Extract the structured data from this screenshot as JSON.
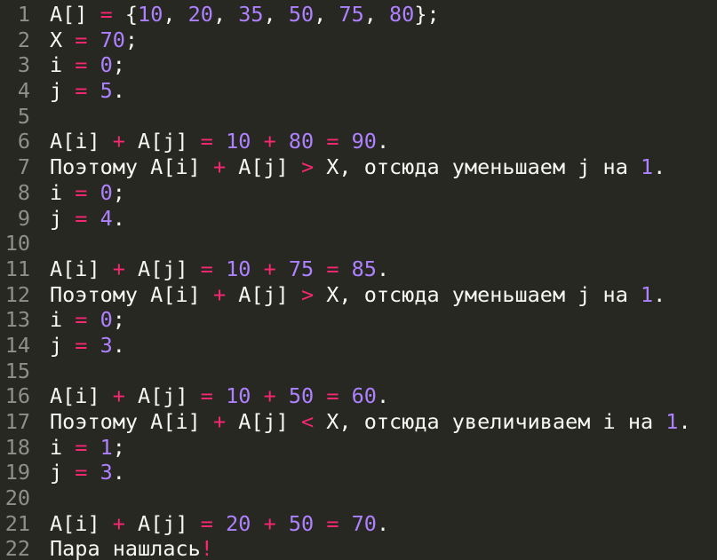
{
  "colors": {
    "background": "#272822",
    "text": "#f8f8f2",
    "line_number": "#90908a",
    "operator": "#f92672",
    "number": "#ae81ff"
  },
  "lines": [
    {
      "num": "1",
      "tokens": [
        [
          "t",
          "A[] "
        ],
        [
          "o",
          "="
        ],
        [
          "t",
          " {"
        ],
        [
          "n",
          "10"
        ],
        [
          "t",
          ", "
        ],
        [
          "n",
          "20"
        ],
        [
          "t",
          ", "
        ],
        [
          "n",
          "35"
        ],
        [
          "t",
          ", "
        ],
        [
          "n",
          "50"
        ],
        [
          "t",
          ", "
        ],
        [
          "n",
          "75"
        ],
        [
          "t",
          ", "
        ],
        [
          "n",
          "80"
        ],
        [
          "t",
          "};"
        ]
      ]
    },
    {
      "num": "2",
      "tokens": [
        [
          "t",
          "X "
        ],
        [
          "o",
          "="
        ],
        [
          "t",
          " "
        ],
        [
          "n",
          "70"
        ],
        [
          "t",
          ";"
        ]
      ]
    },
    {
      "num": "3",
      "tokens": [
        [
          "t",
          "i "
        ],
        [
          "o",
          "="
        ],
        [
          "t",
          " "
        ],
        [
          "n",
          "0"
        ],
        [
          "t",
          ";"
        ]
      ]
    },
    {
      "num": "4",
      "tokens": [
        [
          "t",
          "j "
        ],
        [
          "o",
          "="
        ],
        [
          "t",
          " "
        ],
        [
          "n",
          "5"
        ],
        [
          "t",
          "."
        ]
      ]
    },
    {
      "num": "5",
      "tokens": []
    },
    {
      "num": "6",
      "tokens": [
        [
          "t",
          "A[i] "
        ],
        [
          "o",
          "+"
        ],
        [
          "t",
          " A[j] "
        ],
        [
          "o",
          "="
        ],
        [
          "t",
          " "
        ],
        [
          "n",
          "10"
        ],
        [
          "t",
          " "
        ],
        [
          "o",
          "+"
        ],
        [
          "t",
          " "
        ],
        [
          "n",
          "80"
        ],
        [
          "t",
          " "
        ],
        [
          "o",
          "="
        ],
        [
          "t",
          " "
        ],
        [
          "n",
          "90"
        ],
        [
          "t",
          "."
        ]
      ]
    },
    {
      "num": "7",
      "tokens": [
        [
          "t",
          "Поэтому A[i] "
        ],
        [
          "o",
          "+"
        ],
        [
          "t",
          " A[j] "
        ],
        [
          "o",
          ">"
        ],
        [
          "t",
          " X, отсюда уменьшаем j на "
        ],
        [
          "n",
          "1"
        ],
        [
          "t",
          "."
        ]
      ]
    },
    {
      "num": "8",
      "tokens": [
        [
          "t",
          "i "
        ],
        [
          "o",
          "="
        ],
        [
          "t",
          " "
        ],
        [
          "n",
          "0"
        ],
        [
          "t",
          ";"
        ]
      ]
    },
    {
      "num": "9",
      "tokens": [
        [
          "t",
          "j "
        ],
        [
          "o",
          "="
        ],
        [
          "t",
          " "
        ],
        [
          "n",
          "4"
        ],
        [
          "t",
          "."
        ]
      ]
    },
    {
      "num": "10",
      "tokens": []
    },
    {
      "num": "11",
      "tokens": [
        [
          "t",
          "A[i] "
        ],
        [
          "o",
          "+"
        ],
        [
          "t",
          " A[j] "
        ],
        [
          "o",
          "="
        ],
        [
          "t",
          " "
        ],
        [
          "n",
          "10"
        ],
        [
          "t",
          " "
        ],
        [
          "o",
          "+"
        ],
        [
          "t",
          " "
        ],
        [
          "n",
          "75"
        ],
        [
          "t",
          " "
        ],
        [
          "o",
          "="
        ],
        [
          "t",
          " "
        ],
        [
          "n",
          "85"
        ],
        [
          "t",
          "."
        ]
      ]
    },
    {
      "num": "12",
      "tokens": [
        [
          "t",
          "Поэтому A[i] "
        ],
        [
          "o",
          "+"
        ],
        [
          "t",
          " A[j] "
        ],
        [
          "o",
          ">"
        ],
        [
          "t",
          " X, отсюда уменьшаем j на "
        ],
        [
          "n",
          "1"
        ],
        [
          "t",
          "."
        ]
      ]
    },
    {
      "num": "13",
      "tokens": [
        [
          "t",
          "i "
        ],
        [
          "o",
          "="
        ],
        [
          "t",
          " "
        ],
        [
          "n",
          "0"
        ],
        [
          "t",
          ";"
        ]
      ]
    },
    {
      "num": "14",
      "tokens": [
        [
          "t",
          "j "
        ],
        [
          "o",
          "="
        ],
        [
          "t",
          " "
        ],
        [
          "n",
          "3"
        ],
        [
          "t",
          "."
        ]
      ]
    },
    {
      "num": "15",
      "tokens": []
    },
    {
      "num": "16",
      "tokens": [
        [
          "t",
          "A[i] "
        ],
        [
          "o",
          "+"
        ],
        [
          "t",
          " A[j] "
        ],
        [
          "o",
          "="
        ],
        [
          "t",
          " "
        ],
        [
          "n",
          "10"
        ],
        [
          "t",
          " "
        ],
        [
          "o",
          "+"
        ],
        [
          "t",
          " "
        ],
        [
          "n",
          "50"
        ],
        [
          "t",
          " "
        ],
        [
          "o",
          "="
        ],
        [
          "t",
          " "
        ],
        [
          "n",
          "60"
        ],
        [
          "t",
          "."
        ]
      ]
    },
    {
      "num": "17",
      "tokens": [
        [
          "t",
          "Поэтому A[i] "
        ],
        [
          "o",
          "+"
        ],
        [
          "t",
          " A[j] "
        ],
        [
          "o",
          "<"
        ],
        [
          "t",
          " X, отсюда увеличиваем i на "
        ],
        [
          "n",
          "1"
        ],
        [
          "t",
          "."
        ]
      ]
    },
    {
      "num": "18",
      "tokens": [
        [
          "t",
          "i "
        ],
        [
          "o",
          "="
        ],
        [
          "t",
          " "
        ],
        [
          "n",
          "1"
        ],
        [
          "t",
          ";"
        ]
      ]
    },
    {
      "num": "19",
      "tokens": [
        [
          "t",
          "j "
        ],
        [
          "o",
          "="
        ],
        [
          "t",
          " "
        ],
        [
          "n",
          "3"
        ],
        [
          "t",
          "."
        ]
      ]
    },
    {
      "num": "20",
      "tokens": []
    },
    {
      "num": "21",
      "tokens": [
        [
          "t",
          "A[i] "
        ],
        [
          "o",
          "+"
        ],
        [
          "t",
          " A[j] "
        ],
        [
          "o",
          "="
        ],
        [
          "t",
          " "
        ],
        [
          "n",
          "20"
        ],
        [
          "t",
          " "
        ],
        [
          "o",
          "+"
        ],
        [
          "t",
          " "
        ],
        [
          "n",
          "50"
        ],
        [
          "t",
          " "
        ],
        [
          "o",
          "="
        ],
        [
          "t",
          " "
        ],
        [
          "n",
          "70"
        ],
        [
          "t",
          "."
        ]
      ]
    },
    {
      "num": "22",
      "tokens": [
        [
          "t",
          "Пара нашлась"
        ],
        [
          "o",
          "!"
        ]
      ]
    }
  ]
}
